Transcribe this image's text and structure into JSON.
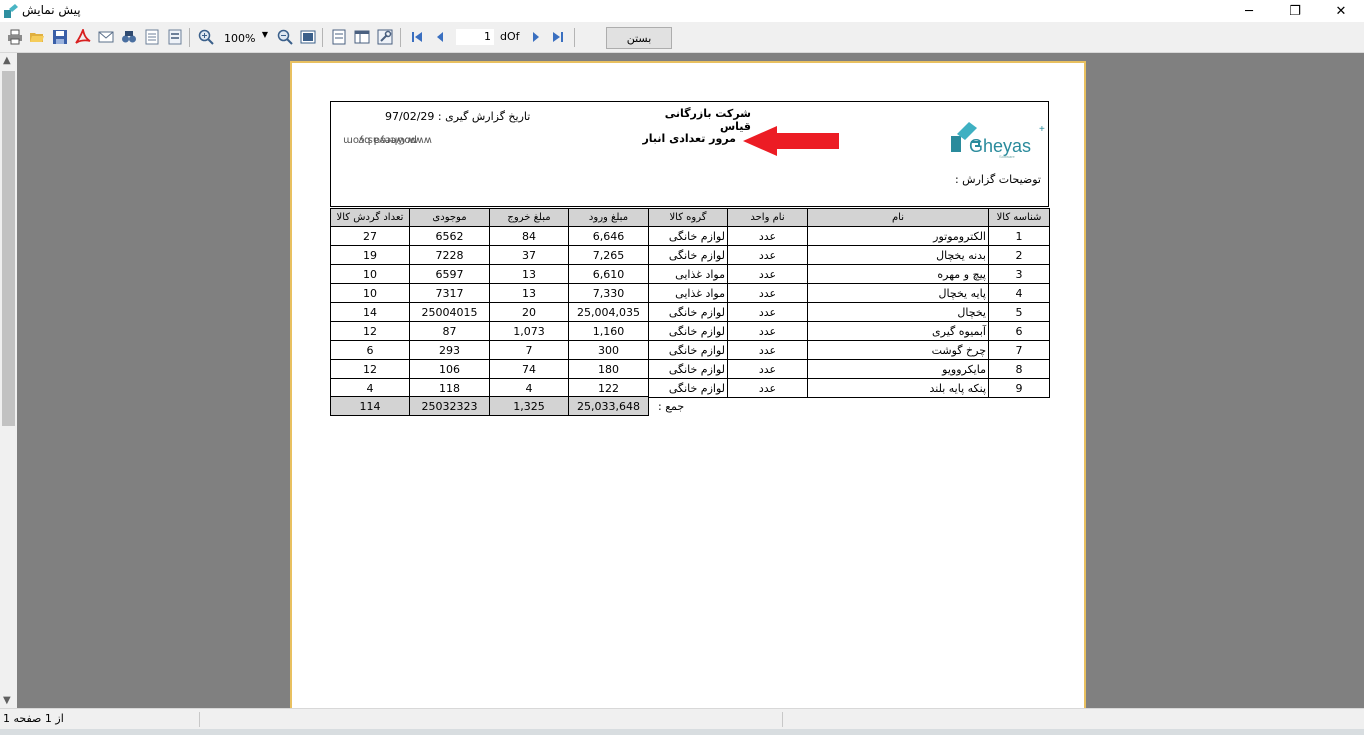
{
  "window": {
    "title": "پیش نمایش",
    "minimize_glyph": "─",
    "restore_glyph": "❐",
    "close_glyph": "✕"
  },
  "toolbar": {
    "zoom": "100%",
    "page_number": "1",
    "of_label": "dOf",
    "close_button": "بستن",
    "icons": [
      "print-icon",
      "open-icon",
      "save-icon",
      "pdf-icon",
      "email-icon",
      "find-icon",
      "page-setup-icon",
      "export-icon",
      "zoom-in-icon",
      "zoom-out-icon",
      "fit-page-icon",
      "single-page-icon",
      "two-page-icon",
      "settings-icon",
      "first-page-icon",
      "prev-page-icon",
      "next-page-icon",
      "last-page-icon"
    ]
  },
  "report": {
    "powered_line1": "powered by",
    "powered_line2": "www.Gheyas.com",
    "date_label": "تاریخ گزارش گیری : 97/02/29",
    "company": "شرکت بازرگانی قیاس",
    "title": "مرور تعدادی انبار",
    "logo_text": "Gheyas",
    "logo_sub": "Software",
    "description_label": "توضیحات گزارش :",
    "columns": [
      "شناسه کالا",
      "نام",
      "نام واحد",
      "گروه کالا",
      "مبلغ ورود",
      "مبلغ خروج",
      "موجودی",
      "تعداد گردش کالا"
    ],
    "rows": [
      {
        "id": "1",
        "name": "الکتروموتور",
        "unit": "عدد",
        "group": "لوازم خانگی",
        "in": "6,646",
        "out": "84",
        "stock": "6562",
        "turnover": "27"
      },
      {
        "id": "2",
        "name": "بدنه یخچال",
        "unit": "عدد",
        "group": "لوازم خانگی",
        "in": "7,265",
        "out": "37",
        "stock": "7228",
        "turnover": "19"
      },
      {
        "id": "3",
        "name": "پیچ و مهره",
        "unit": "عدد",
        "group": "مواد غذایی",
        "in": "6,610",
        "out": "13",
        "stock": "6597",
        "turnover": "10"
      },
      {
        "id": "4",
        "name": "پایه یخچال",
        "unit": "عدد",
        "group": "مواد غذایی",
        "in": "7,330",
        "out": "13",
        "stock": "7317",
        "turnover": "10"
      },
      {
        "id": "5",
        "name": "یخچال",
        "unit": "عدد",
        "group": "لوازم خانگی",
        "in": "25,004,035",
        "out": "20",
        "stock": "25004015",
        "turnover": "14"
      },
      {
        "id": "6",
        "name": "آبمیوه گیری",
        "unit": "عدد",
        "group": "لوازم خانگی",
        "in": "1,160",
        "out": "1,073",
        "stock": "87",
        "turnover": "12"
      },
      {
        "id": "7",
        "name": "چرخ گوشت",
        "unit": "عدد",
        "group": "لوازم خانگی",
        "in": "300",
        "out": "7",
        "stock": "293",
        "turnover": "6"
      },
      {
        "id": "8",
        "name": "مایکروویو",
        "unit": "عدد",
        "group": "لوازم خانگی",
        "in": "180",
        "out": "74",
        "stock": "106",
        "turnover": "12"
      },
      {
        "id": "9",
        "name": "پنکه پایه بلند",
        "unit": "عدد",
        "group": "لوازم خانگی",
        "in": "122",
        "out": "4",
        "stock": "118",
        "turnover": "4"
      }
    ],
    "totals": {
      "in": "25,033,648",
      "out": "1,325",
      "stock": "25032323",
      "turnover": "114"
    },
    "sum_label": "جمع :"
  },
  "status": {
    "page_info": "از 1 صفحه 1"
  }
}
